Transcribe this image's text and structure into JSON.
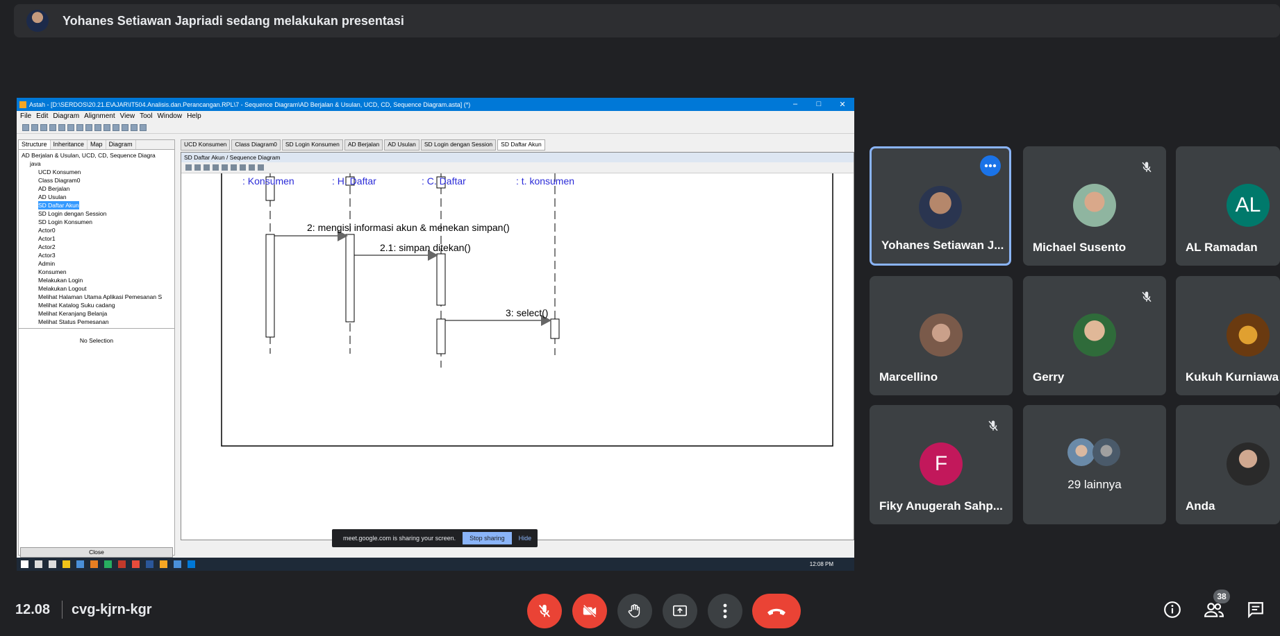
{
  "presenter_banner": "Yohanes Setiawan Japriadi sedang melakukan presentasi",
  "app": {
    "title": "Astah - [D:\\SERDOS\\20.21.E\\AJAR\\IT504.Analisis.dan.Perancangan.RPL\\7 - Sequence Diagram\\AD Berjalan & Usulan, UCD, CD, Sequence Diagram.asta] (*)",
    "menu": [
      "File",
      "Edit",
      "Diagram",
      "Alignment",
      "View",
      "Tool",
      "Window",
      "Help"
    ],
    "panel_tabs": [
      "Structure",
      "Inheritance",
      "Map",
      "Diagram"
    ],
    "tree": [
      "AD Berjalan & Usulan, UCD, CD, Sequence Diagra",
      "java",
      "UCD Konsumen",
      "Class Diagram0",
      "AD Berjalan",
      "AD Usulan",
      "SD Daftar Akun",
      "SD Login dengan Session",
      "SD Login Konsumen",
      "Actor0",
      "Actor1",
      "Actor2",
      "Actor3",
      "Admin",
      "Konsumen",
      "Melakukan Login",
      "Melakukan Logout",
      "Melihat Halaman Utama Aplikasi Pemesanan S",
      "Melihat Katalog Suku cadang",
      "Melihat Keranjang Belanja",
      "Melihat Status Pemesanan"
    ],
    "no_selection": "No Selection",
    "close_label": "Close",
    "doc_tabs": [
      "UCD Konsumen",
      "Class Diagram0",
      "SD Login Konsumen",
      "AD Berjalan",
      "AD Usulan",
      "SD Login dengan Session",
      "SD Daftar Akun"
    ],
    "diagram_title": "SD Daftar Akun / Sequence Diagram",
    "lifelines": [
      ": Konsumen",
      ": H. Daftar",
      ": C. Daftar",
      ": t. konsumen"
    ],
    "messages": [
      "2: mengisi informasi akun & menekan simpan()",
      "2.1: simpan ditekan()",
      "3: select()"
    ],
    "share_banner": {
      "text": "meet.google.com is sharing your screen.",
      "stop": "Stop sharing",
      "hide": "Hide"
    },
    "taskbar_clock": "12:08 PM"
  },
  "participants": [
    {
      "name": "Yohanes Setiawan J...",
      "avatar_type": "photo",
      "speaking": true,
      "muted": false
    },
    {
      "name": "Michael Susento",
      "avatar_type": "photo",
      "speaking": false,
      "muted": true
    },
    {
      "name": "AL Ramadan",
      "avatar_type": "initials",
      "initials": "AL",
      "color": "#00796b",
      "muted": false
    },
    {
      "name": "Marcellino",
      "avatar_type": "photo",
      "muted": false
    },
    {
      "name": "Gerry",
      "avatar_type": "photo",
      "muted": true
    },
    {
      "name": "Kukuh Kurniawa",
      "avatar_type": "photo",
      "muted": false
    },
    {
      "name": "Fiky Anugerah Sahp...",
      "avatar_type": "initials",
      "initials": "F",
      "color": "#c2185b",
      "muted": true
    },
    {
      "name": "29 lainnya",
      "avatar_type": "group",
      "muted": false
    },
    {
      "name": "Anda",
      "avatar_type": "photo",
      "muted": false
    }
  ],
  "bottom": {
    "time": "12.08",
    "meeting_code": "cvg-kjrn-kgr",
    "people_count": "38"
  },
  "colors": {
    "mute_red": "#ea4335",
    "speaking_border": "#8ab4f8",
    "tile_bg": "#3c4043"
  }
}
